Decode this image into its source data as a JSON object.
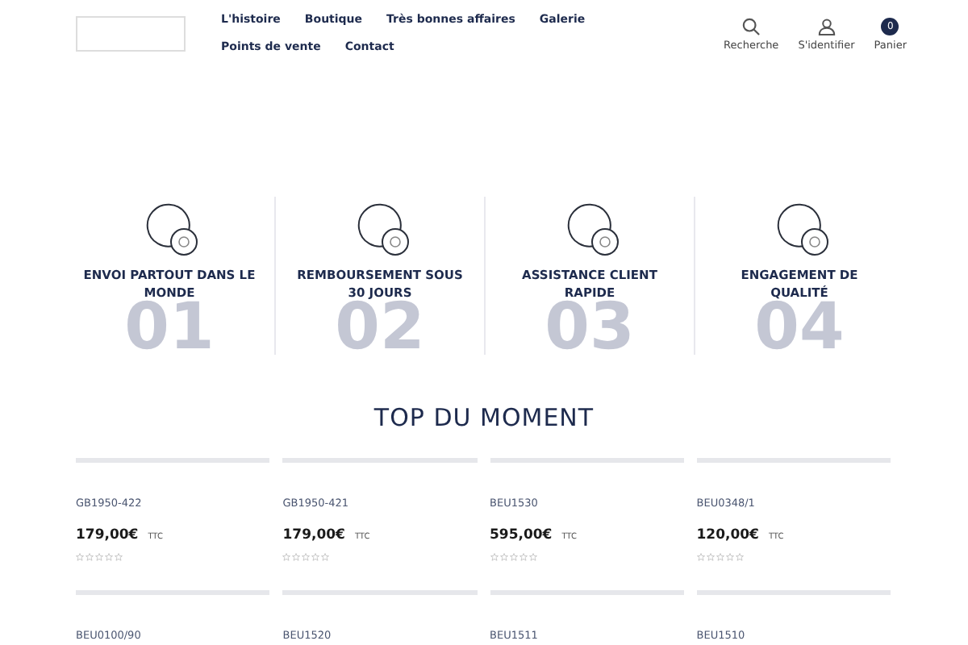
{
  "nav": {
    "links": [
      {
        "label": "L'histoire"
      },
      {
        "label": "Boutique"
      },
      {
        "label": "Très bonnes affaires"
      },
      {
        "label": "Galerie"
      },
      {
        "label": "Points de vente"
      },
      {
        "label": "Contact"
      }
    ],
    "actions": [
      {
        "kind": "search",
        "label": "Recherche"
      },
      {
        "kind": "user",
        "label": "S'identifier"
      },
      {
        "kind": "cart",
        "label": "Panier",
        "count": "0"
      }
    ]
  },
  "features": [
    {
      "title": "ENVOI PARTOUT DANS LE MONDE",
      "number": "01"
    },
    {
      "title": "REMBOURSEMENT SOUS 30 JOURS",
      "number": "02"
    },
    {
      "title": "ASSISTANCE CLIENT RAPIDE",
      "number": "03"
    },
    {
      "title": "ENGAGEMENT DE QUALITÉ",
      "number": "04"
    }
  ],
  "section_title": "TOP DU MOMENT",
  "products": [
    {
      "ref": "GB1950-422",
      "price": "179,00€",
      "tax": "TTC",
      "stars": 0
    },
    {
      "ref": "GB1950-421",
      "price": "179,00€",
      "tax": "TTC",
      "stars": 0
    },
    {
      "ref": "BEU1530",
      "price": "595,00€",
      "tax": "TTC",
      "stars": 0
    },
    {
      "ref": "BEU0348/1",
      "price": "120,00€",
      "tax": "TTC",
      "stars": 0
    },
    {
      "ref": "BEU0100/90"
    },
    {
      "ref": "BEU1520"
    },
    {
      "ref": "BEU1511"
    },
    {
      "ref": "BEU1510"
    }
  ]
}
